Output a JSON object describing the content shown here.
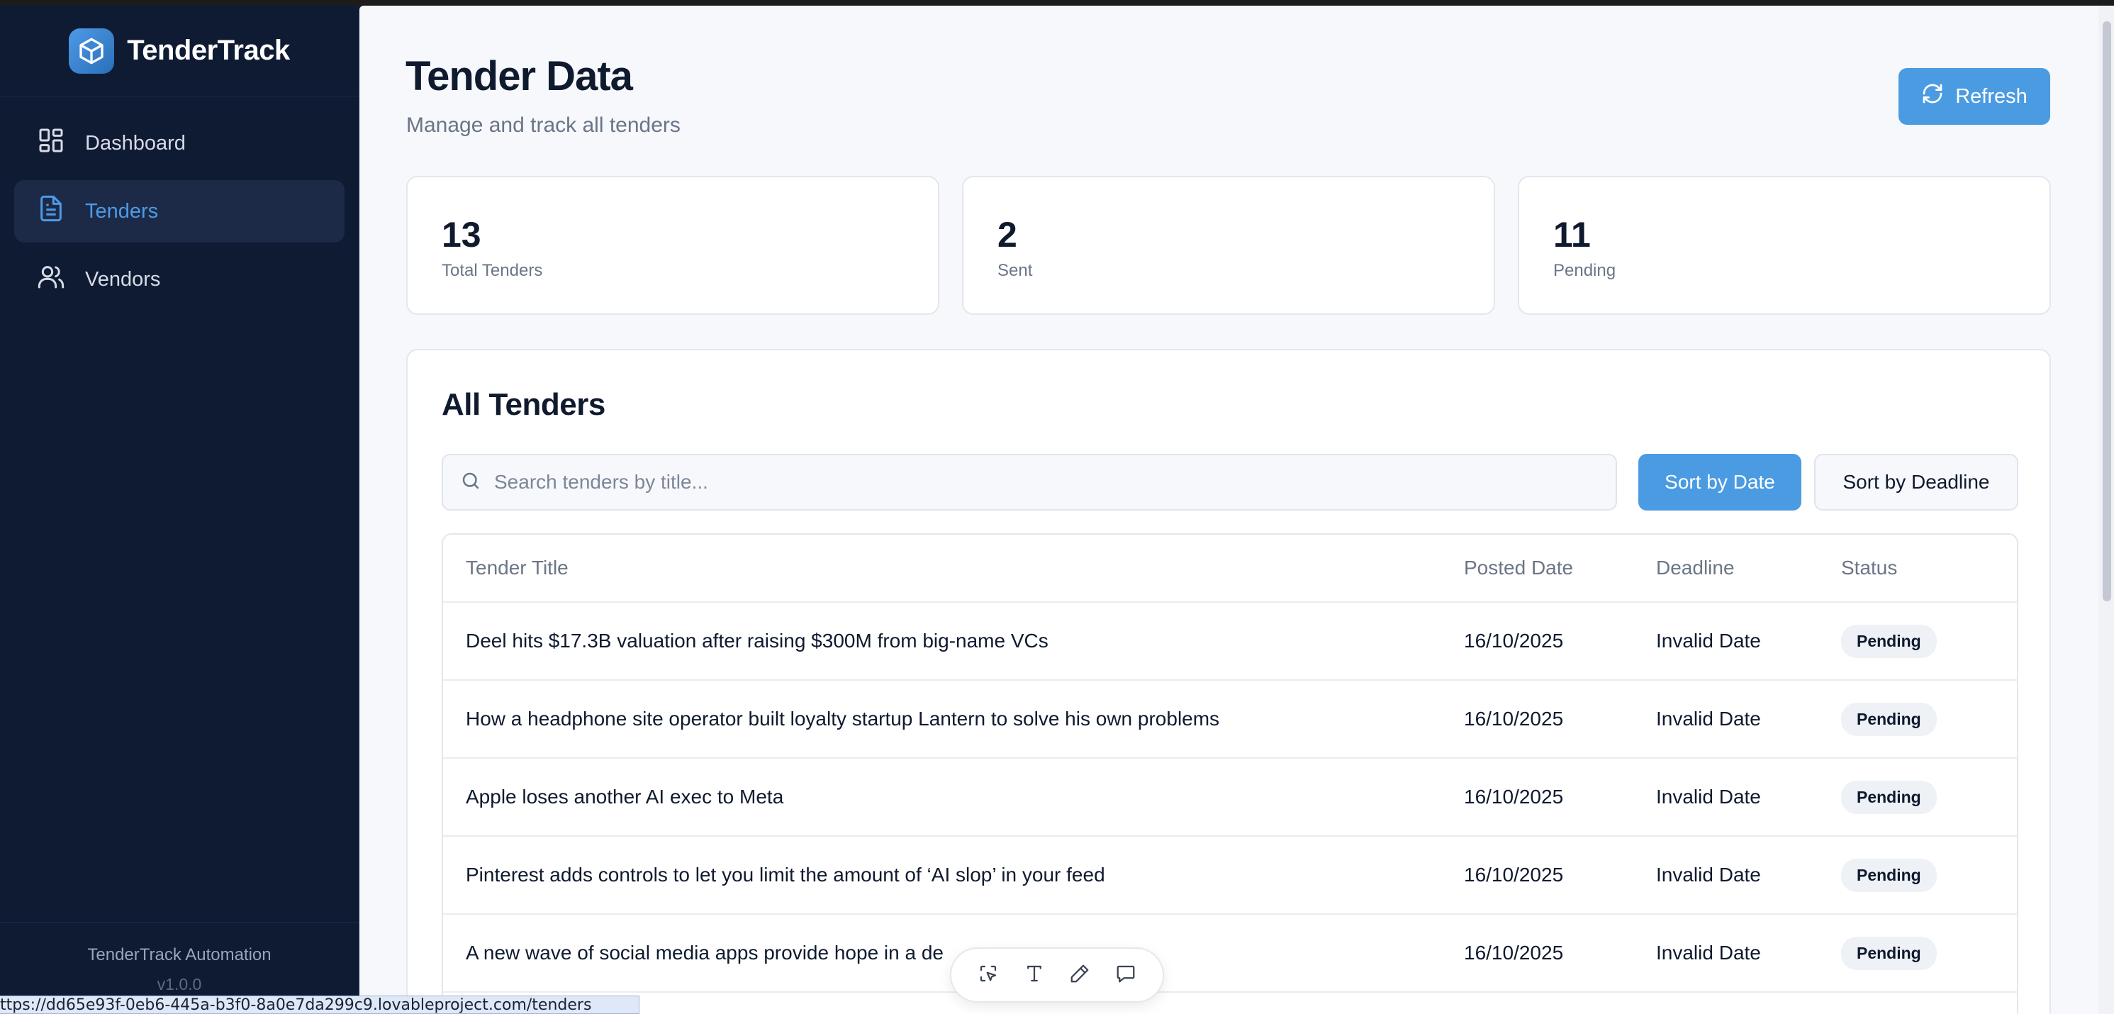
{
  "app": {
    "name": "TenderTrack",
    "footer_title": "TenderTrack Automation",
    "footer_version": "v1.0.0"
  },
  "sidebar": {
    "items": [
      {
        "label": "Dashboard",
        "icon": "dashboard-grid-icon",
        "active": false
      },
      {
        "label": "Tenders",
        "icon": "document-icon",
        "active": true
      },
      {
        "label": "Vendors",
        "icon": "users-icon",
        "active": false
      }
    ]
  },
  "header": {
    "title": "Tender Data",
    "subtitle": "Manage and track all tenders",
    "refresh_label": "Refresh"
  },
  "stats": [
    {
      "value": "13",
      "label": "Total Tenders"
    },
    {
      "value": "2",
      "label": "Sent"
    },
    {
      "value": "11",
      "label": "Pending"
    }
  ],
  "tenders_panel": {
    "title": "All Tenders",
    "search_placeholder": "Search tenders by title...",
    "sort_date_label": "Sort by Date",
    "sort_deadline_label": "Sort by Deadline",
    "columns": [
      "Tender Title",
      "Posted Date",
      "Deadline",
      "Status"
    ],
    "rows": [
      {
        "title": "Deel hits $17.3B valuation after raising $300M from big-name VCs",
        "posted": "16/10/2025",
        "deadline": "Invalid Date",
        "status": "Pending"
      },
      {
        "title": "How a headphone site operator built loyalty startup Lantern to solve his own problems",
        "posted": "16/10/2025",
        "deadline": "Invalid Date",
        "status": "Pending"
      },
      {
        "title": "Apple loses another AI exec to Meta",
        "posted": "16/10/2025",
        "deadline": "Invalid Date",
        "status": "Pending"
      },
      {
        "title": "Pinterest adds controls to let you limit the amount of ‘AI slop’ in your feed",
        "posted": "16/10/2025",
        "deadline": "Invalid Date",
        "status": "Pending"
      },
      {
        "title": "A new wave of social media apps provide hope in a de",
        "posted": "16/10/2025",
        "deadline": "Invalid Date",
        "status": "Pending"
      }
    ]
  },
  "status_bar": {
    "url": "ttps://dd65e93f-0eb6-445a-b3f0-8a0e7da299c9.lovableproject.com/tenders"
  },
  "colors": {
    "sidebar_bg": "#0f1a33",
    "accent": "#4a9be2",
    "main_bg": "#f6f8fb"
  }
}
